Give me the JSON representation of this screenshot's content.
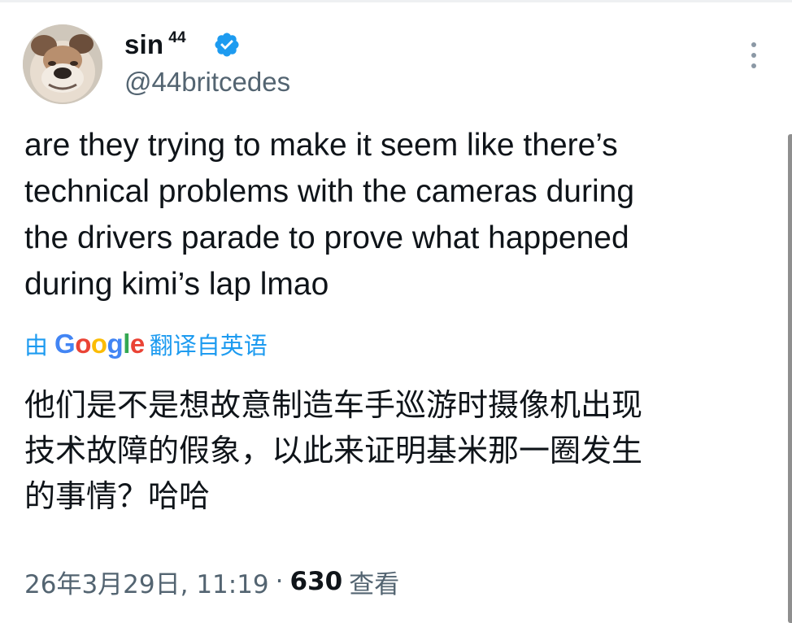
{
  "author": {
    "display_name": "sin",
    "display_name_sup": "44",
    "handle": "@44britcedes",
    "avatar_icon": "bulldog-avatar",
    "verified_icon": "verified-badge-icon",
    "verified_color": "#1d9bf0"
  },
  "tweet": {
    "text": "are they trying to make it seem like there’s\ntechnical problems with the cameras during\nthe drivers parade to prove what happened\nduring kimi’s lap lmao",
    "translation_prefix": "由",
    "translation_brand": "Google",
    "translation_suffix": "翻译自英语",
    "translated_text": "他们是不是想故意制造车手巡游时摄像机出现\n技术故障的假象，以此来证明基米那一圈发生\n的事情？哈哈"
  },
  "meta": {
    "timestamp": "26年3月29日, 11:19",
    "separator": "·",
    "views_count": "630",
    "views_label": "查看"
  },
  "colors": {
    "text": "#0f1419",
    "secondary": "#536471",
    "link": "#1d9bf0"
  },
  "more_icon": "more-vertical-icon"
}
